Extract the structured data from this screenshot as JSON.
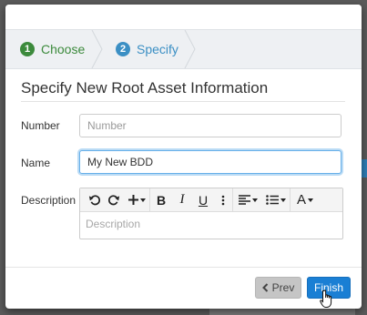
{
  "wizard": {
    "steps": [
      {
        "number": "1",
        "label": "Choose"
      },
      {
        "number": "2",
        "label": "Specify"
      }
    ]
  },
  "form": {
    "title": "Specify New Root Asset Information",
    "number": {
      "label": "Number",
      "placeholder": "Number",
      "value": ""
    },
    "name": {
      "label": "Name",
      "value": "My New BDD"
    },
    "description": {
      "label": "Description",
      "placeholder": "Description"
    }
  },
  "toolbar": {
    "buttons": [
      "undo-icon",
      "redo-icon",
      "plus-icon",
      "bold-icon",
      "italic-icon",
      "underline-icon",
      "more-icon",
      "align-icon",
      "list-icon",
      "font-icon"
    ]
  },
  "footer": {
    "prev_label": "Prev",
    "finish_label": "Finish"
  },
  "colors": {
    "step_done": "#3c8a3c",
    "step_active": "#3b8fc4",
    "primary_button": "#1a7fd4",
    "secondary_button": "#c5c5c5"
  }
}
